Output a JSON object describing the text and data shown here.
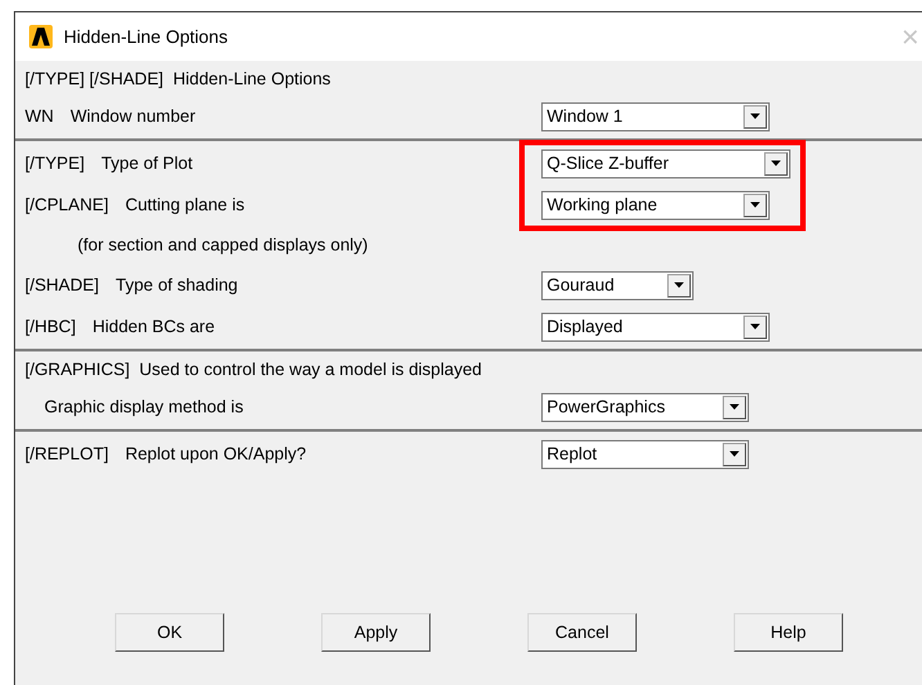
{
  "window": {
    "title": "Hidden-Line Options",
    "close": "×"
  },
  "sections": [
    {
      "rows": [
        {
          "kind": "heading",
          "text": "[/TYPE] [/SHADE]  Hidden-Line Options"
        },
        {
          "kind": "field",
          "code": "WN",
          "label": "Window number",
          "value": "Window 1",
          "highlighted": false
        }
      ]
    },
    {
      "rows": [
        {
          "kind": "field",
          "code": "[/TYPE]",
          "label": "Type of Plot",
          "value": "Q-Slice Z-buffer",
          "highlighted": true
        },
        {
          "kind": "field",
          "code": "[/CPLANE]",
          "label": "Cutting plane is",
          "value": "Working plane",
          "highlighted": true
        },
        {
          "kind": "note",
          "text": "(for section and capped displays only)"
        },
        {
          "kind": "field",
          "code": "[/SHADE]",
          "label": "Type of shading",
          "value": "Gouraud",
          "highlighted": false
        },
        {
          "kind": "field",
          "code": "[/HBC]",
          "label": "Hidden BCs are",
          "value": "Displayed",
          "highlighted": false
        }
      ]
    },
    {
      "rows": [
        {
          "kind": "heading",
          "text": "[/GRAPHICS]  Used to control the way a model is displayed"
        },
        {
          "kind": "field",
          "label": "Graphic display method is",
          "value": "PowerGraphics",
          "highlighted": false
        }
      ]
    },
    {
      "rows": [
        {
          "kind": "field",
          "code": "[/REPLOT]",
          "label": "Replot upon OK/Apply?",
          "value": "Replot",
          "highlighted": false
        }
      ]
    }
  ],
  "buttons": [
    "OK",
    "Apply",
    "Cancel",
    "Help"
  ]
}
